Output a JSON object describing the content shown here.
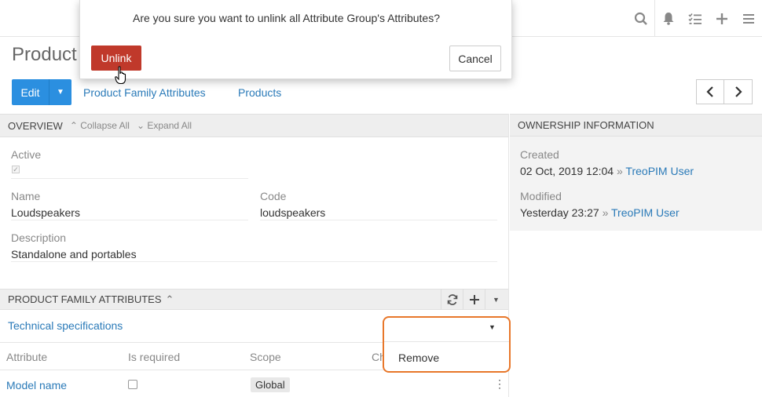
{
  "topbar": {
    "icons": [
      "search-icon",
      "bell-icon",
      "tasks-icon",
      "plus-icon",
      "menu-icon"
    ]
  },
  "page": {
    "title": "Product"
  },
  "actions": {
    "edit_label": "Edit",
    "links": [
      "Product Family Attributes",
      "Products"
    ]
  },
  "overview": {
    "title": "OVERVIEW",
    "collapse_all": "Collapse All",
    "expand_all": "Expand All",
    "fields": {
      "active_label": "Active",
      "name_label": "Name",
      "name_value": "Loudspeakers",
      "code_label": "Code",
      "code_value": "loudspeakers",
      "description_label": "Description",
      "description_value": "Standalone and portables"
    }
  },
  "ownership": {
    "title": "OWNERSHIP INFORMATION",
    "created_label": "Created",
    "created_date": "02 Oct, 2019 12:04",
    "created_by": "TreoPIM User",
    "modified_label": "Modified",
    "modified_date": "Yesterday 23:27",
    "modified_by": "TreoPIM User",
    "separator": "»"
  },
  "pfa": {
    "title": "PRODUCT FAMILY ATTRIBUTES",
    "group_title": "Technical specifications",
    "columns": [
      "Attribute",
      "Is required",
      "Scope",
      "Ch"
    ],
    "rows": [
      {
        "attribute": "Model name",
        "is_required": false,
        "scope": "Global"
      }
    ],
    "dropdown": {
      "item": "Remove"
    }
  },
  "modal": {
    "message": "Are you sure you want to unlink all Attribute Group's Attributes?",
    "confirm_label": "Unlink",
    "cancel_label": "Cancel"
  }
}
